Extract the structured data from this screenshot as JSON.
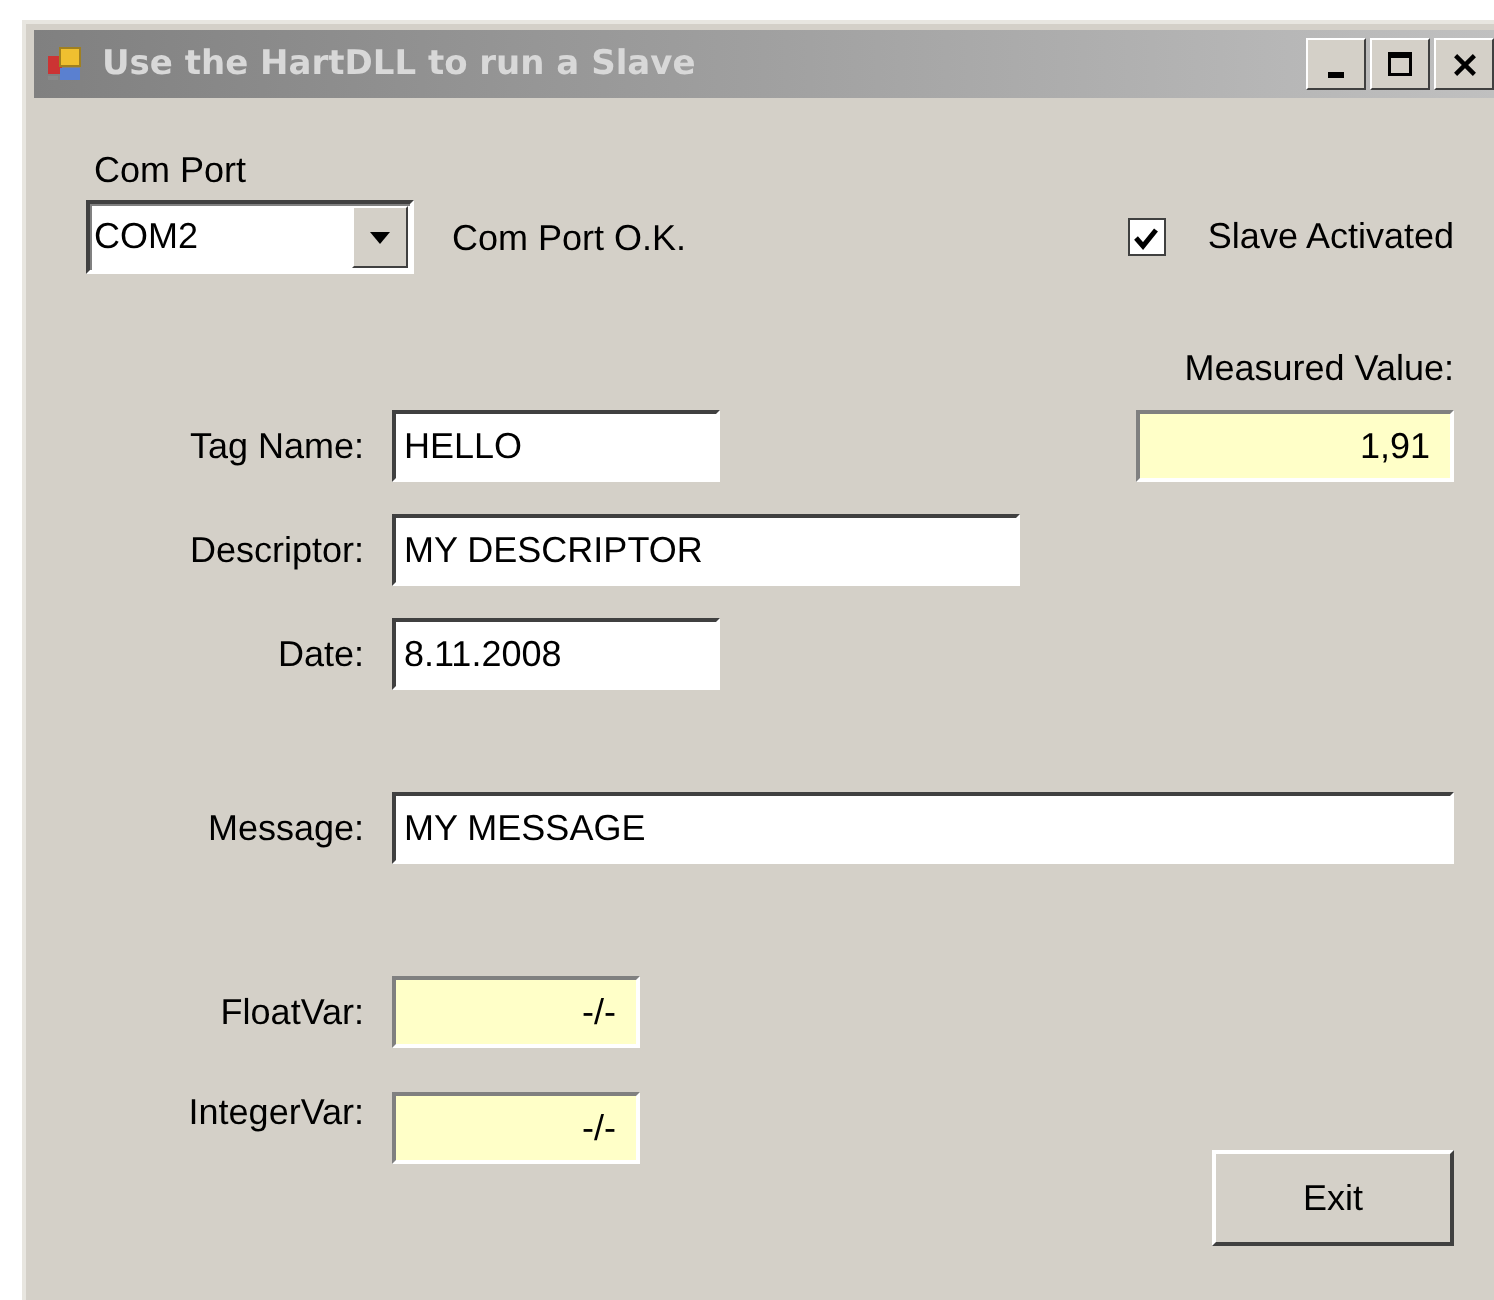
{
  "window": {
    "title": "Use the HartDLL to run a Slave"
  },
  "com_port": {
    "label": "Com Port",
    "value": "COM2",
    "status": "Com Port O.K."
  },
  "slave_activated": {
    "label": "Slave Activated",
    "checked": true
  },
  "measured_value": {
    "label": "Measured Value:",
    "value": "1,91"
  },
  "fields": [
    {
      "label": "Tag Name:",
      "value": "HELLO",
      "kind": "short"
    },
    {
      "label": "Descriptor:",
      "value": "MY DESCRIPTOR",
      "kind": "medium"
    },
    {
      "label": "Date:",
      "value": "8.11.2008",
      "kind": "short"
    },
    {
      "label": "Message:",
      "value": "MY MESSAGE",
      "kind": "long"
    }
  ],
  "variables": [
    {
      "label": "FloatVar:",
      "value": "-/-"
    },
    {
      "label": "IntegerVar:",
      "value": "-/-"
    }
  ],
  "buttons": [
    "Exit"
  ]
}
